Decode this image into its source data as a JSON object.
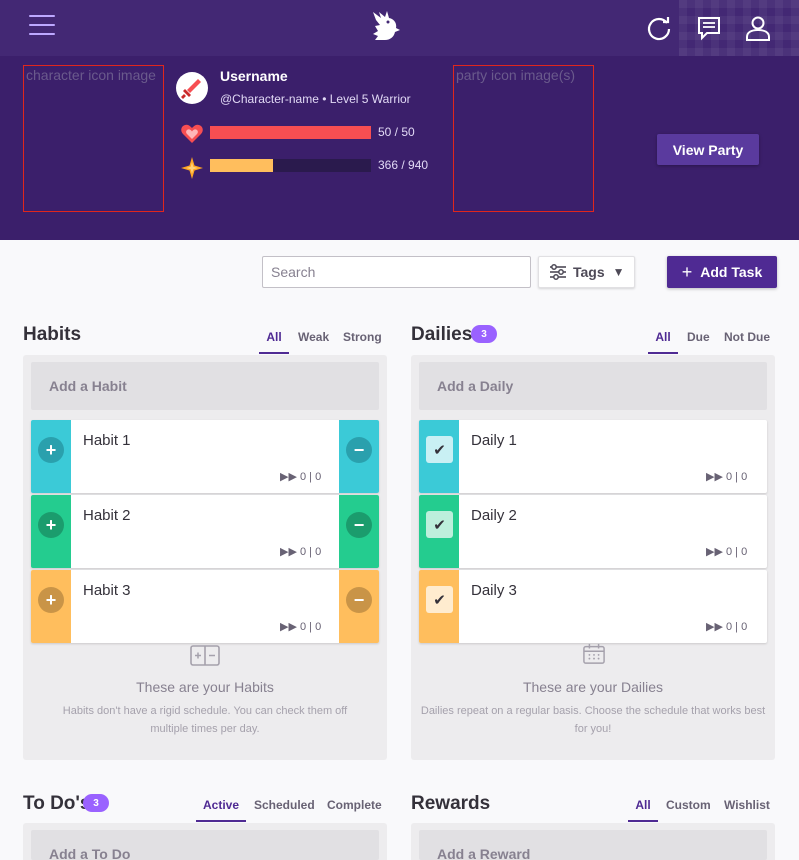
{
  "topbar": {
    "icons": [
      "menu-icon",
      "gryphon-logo",
      "sync-icon",
      "chat-icon",
      "user-icon"
    ]
  },
  "header": {
    "character_placeholder": "character icon image",
    "party_placeholder": "party icon image(s)",
    "username": "Username",
    "character_line": "@Character-name • Level 5 Warrior",
    "health": {
      "label": "50 / 50",
      "current": 50,
      "max": 50,
      "color": "#f74e52"
    },
    "experience": {
      "label": "366 / 940",
      "current": 366,
      "max": 940,
      "color": "#ffbe5d"
    },
    "view_party": "View Party"
  },
  "toolbar": {
    "search_placeholder": "Search",
    "tags_label": "Tags",
    "add_task_label": "Add Task"
  },
  "columns": {
    "habits": {
      "title": "Habits",
      "filters": [
        "All",
        "Weak",
        "Strong"
      ],
      "active_filter": "All",
      "add_label": "Add a Habit",
      "tasks": [
        {
          "title": "Habit 1",
          "streak": "▶▶ 0 | 0",
          "color": "#3bcad7",
          "btn": "#2aa0ad"
        },
        {
          "title": "Habit 2",
          "streak": "▶▶ 0 | 0",
          "color": "#24cc8f",
          "btn": "#1b9c6d"
        },
        {
          "title": "Habit 3",
          "streak": "▶▶ 0 | 0",
          "color": "#ffbe5d",
          "btn": "#c99447"
        }
      ],
      "empty_title": "These are your Habits",
      "empty_desc": "Habits don't have a rigid schedule. You can check them off multiple times per day."
    },
    "dailies": {
      "title": "Dailies",
      "count": "3",
      "filters": [
        "All",
        "Due",
        "Not Due"
      ],
      "active_filter": "All",
      "add_label": "Add a Daily",
      "tasks": [
        {
          "title": "Daily 1",
          "streak": "▶▶ 0 | 0",
          "color": "#3bcad7",
          "box": "#c9f0f4"
        },
        {
          "title": "Daily 2",
          "streak": "▶▶ 0 | 0",
          "color": "#24cc8f",
          "box": "#bdefdc"
        },
        {
          "title": "Daily 3",
          "streak": "▶▶ 0 | 0",
          "color": "#ffbe5d",
          "box": "#ffeccf"
        }
      ],
      "empty_title": "These are your Dailies",
      "empty_desc": "Dailies repeat on a regular basis. Choose the schedule that works best for you!"
    },
    "todos": {
      "title": "To Do's",
      "count": "3",
      "filters": [
        "Active",
        "Scheduled",
        "Complete"
      ],
      "active_filter": "Active",
      "add_label": "Add a To Do"
    },
    "rewards": {
      "title": "Rewards",
      "filters": [
        "All",
        "Custom",
        "Wishlist"
      ],
      "active_filter": "All",
      "add_label": "Add a Reward"
    }
  }
}
